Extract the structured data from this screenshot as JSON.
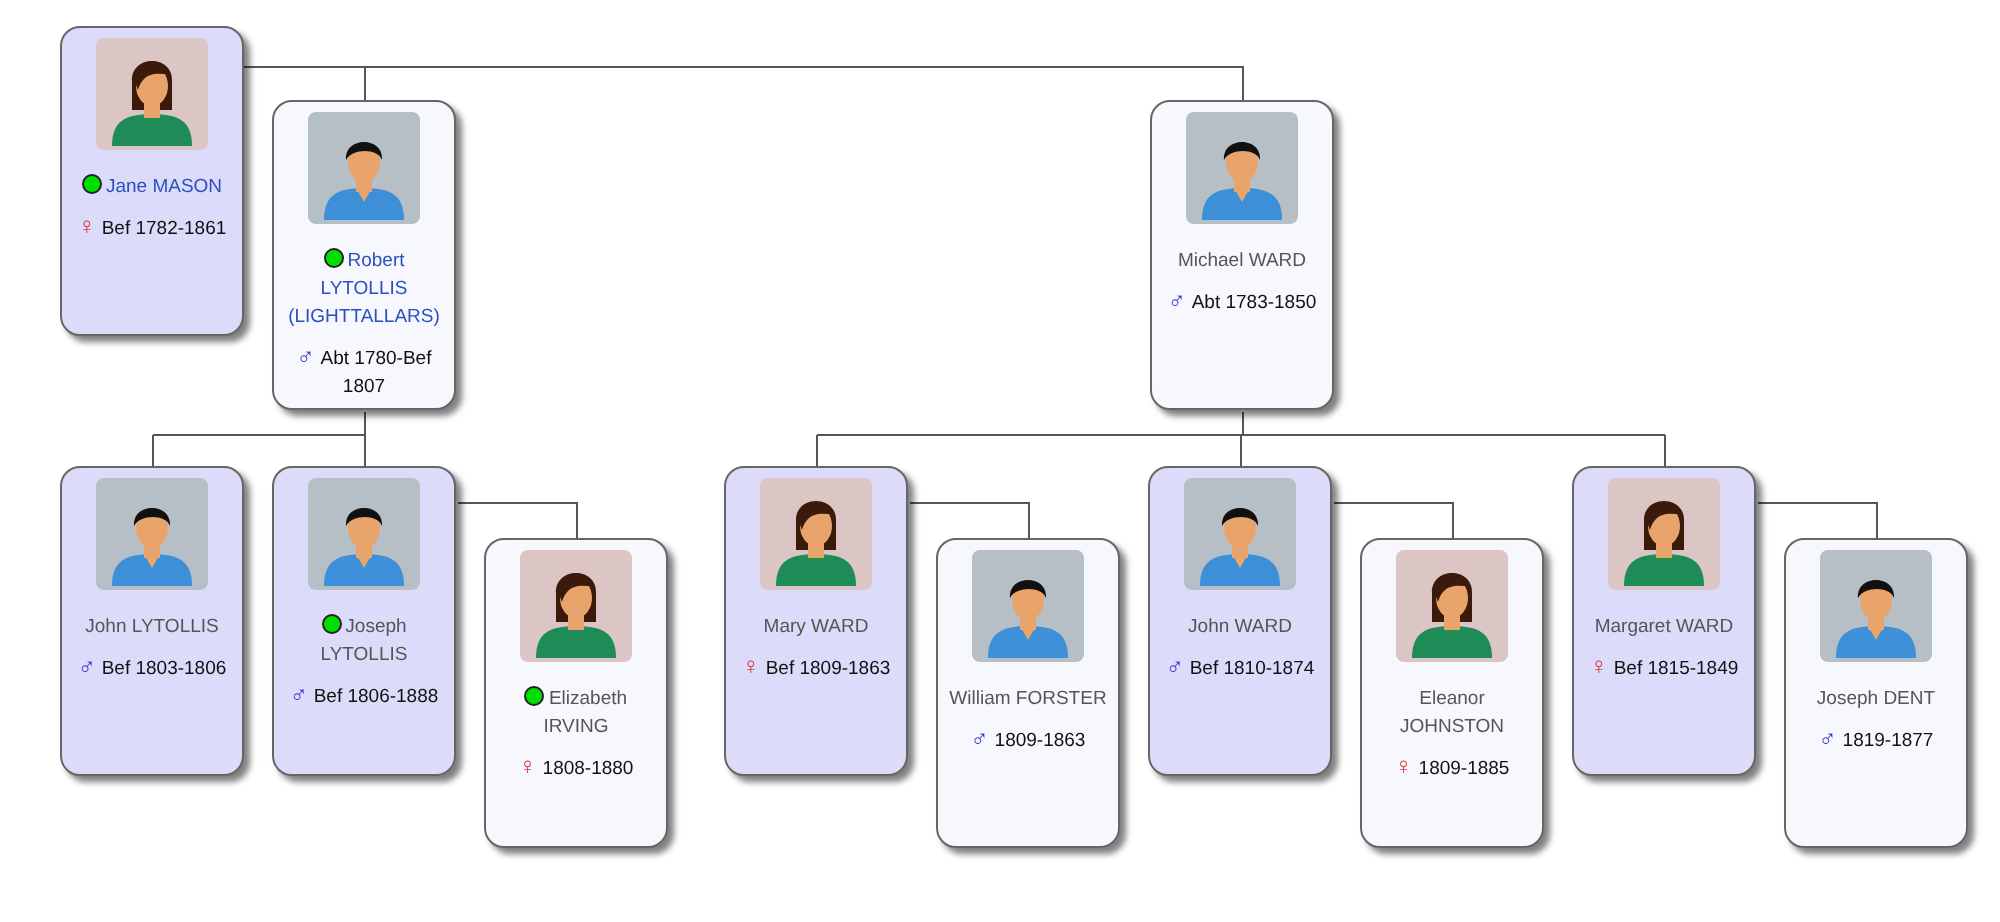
{
  "tree": {
    "person": {
      "name": "Jane MASON",
      "dates": "Bef 1782-1861",
      "kind": "female",
      "symbol": "♀",
      "flagged": true,
      "linked": true,
      "highlighted": true
    },
    "spouses": [
      {
        "person": {
          "name": "Robert LYTOLLIS (LIGHTTALLARS)",
          "dates": "Abt 1780-Bef 1807",
          "kind": "male",
          "symbol": "♂",
          "flagged": true,
          "linked": true,
          "highlighted": false
        },
        "children": [
          {
            "person": {
              "name": "John LYTOLLIS",
              "dates": "Bef 1803-1806",
              "kind": "male",
              "symbol": "♂",
              "flagged": false,
              "linked": false,
              "highlighted": true
            }
          },
          {
            "person": {
              "name": "Joseph LYTOLLIS",
              "dates": "Bef 1806-1888",
              "kind": "male",
              "symbol": "♂",
              "flagged": true,
              "linked": false,
              "highlighted": true
            },
            "spouses": [
              {
                "person": {
                  "name": "Elizabeth IRVING",
                  "dates": "1808-1880",
                  "kind": "female",
                  "symbol": "♀",
                  "flagged": true,
                  "linked": false,
                  "highlighted": false
                }
              }
            ]
          }
        ]
      },
      {
        "person": {
          "name": "Michael WARD",
          "dates": "Abt 1783-1850",
          "kind": "male",
          "symbol": "♂",
          "flagged": false,
          "linked": false,
          "highlighted": false
        },
        "children": [
          {
            "person": {
              "name": "Mary WARD",
              "dates": "Bef 1809-1863",
              "kind": "female",
              "symbol": "♀",
              "flagged": false,
              "linked": false,
              "highlighted": true
            },
            "spouses": [
              {
                "person": {
                  "name": "William FORSTER",
                  "dates": "1809-1863",
                  "kind": "male",
                  "symbol": "♂",
                  "flagged": false,
                  "linked": false,
                  "highlighted": false
                }
              }
            ]
          },
          {
            "person": {
              "name": "John WARD",
              "dates": "Bef 1810-1874",
              "kind": "male",
              "symbol": "♂",
              "flagged": false,
              "linked": false,
              "highlighted": true
            },
            "spouses": [
              {
                "person": {
                  "name": "Eleanor JOHNSTON",
                  "dates": "1809-1885",
                  "kind": "female",
                  "symbol": "♀",
                  "flagged": false,
                  "linked": false,
                  "highlighted": false
                }
              }
            ]
          },
          {
            "person": {
              "name": "Margaret WARD",
              "dates": "Bef 1815-1849",
              "kind": "female",
              "symbol": "♀",
              "flagged": false,
              "linked": false,
              "highlighted": true
            },
            "spouses": [
              {
                "person": {
                  "name": "Joseph DENT",
                  "dates": "1819-1877",
                  "kind": "male",
                  "symbol": "♂",
                  "flagged": false,
                  "linked": false,
                  "highlighted": false
                }
              }
            ]
          }
        ]
      }
    ]
  }
}
